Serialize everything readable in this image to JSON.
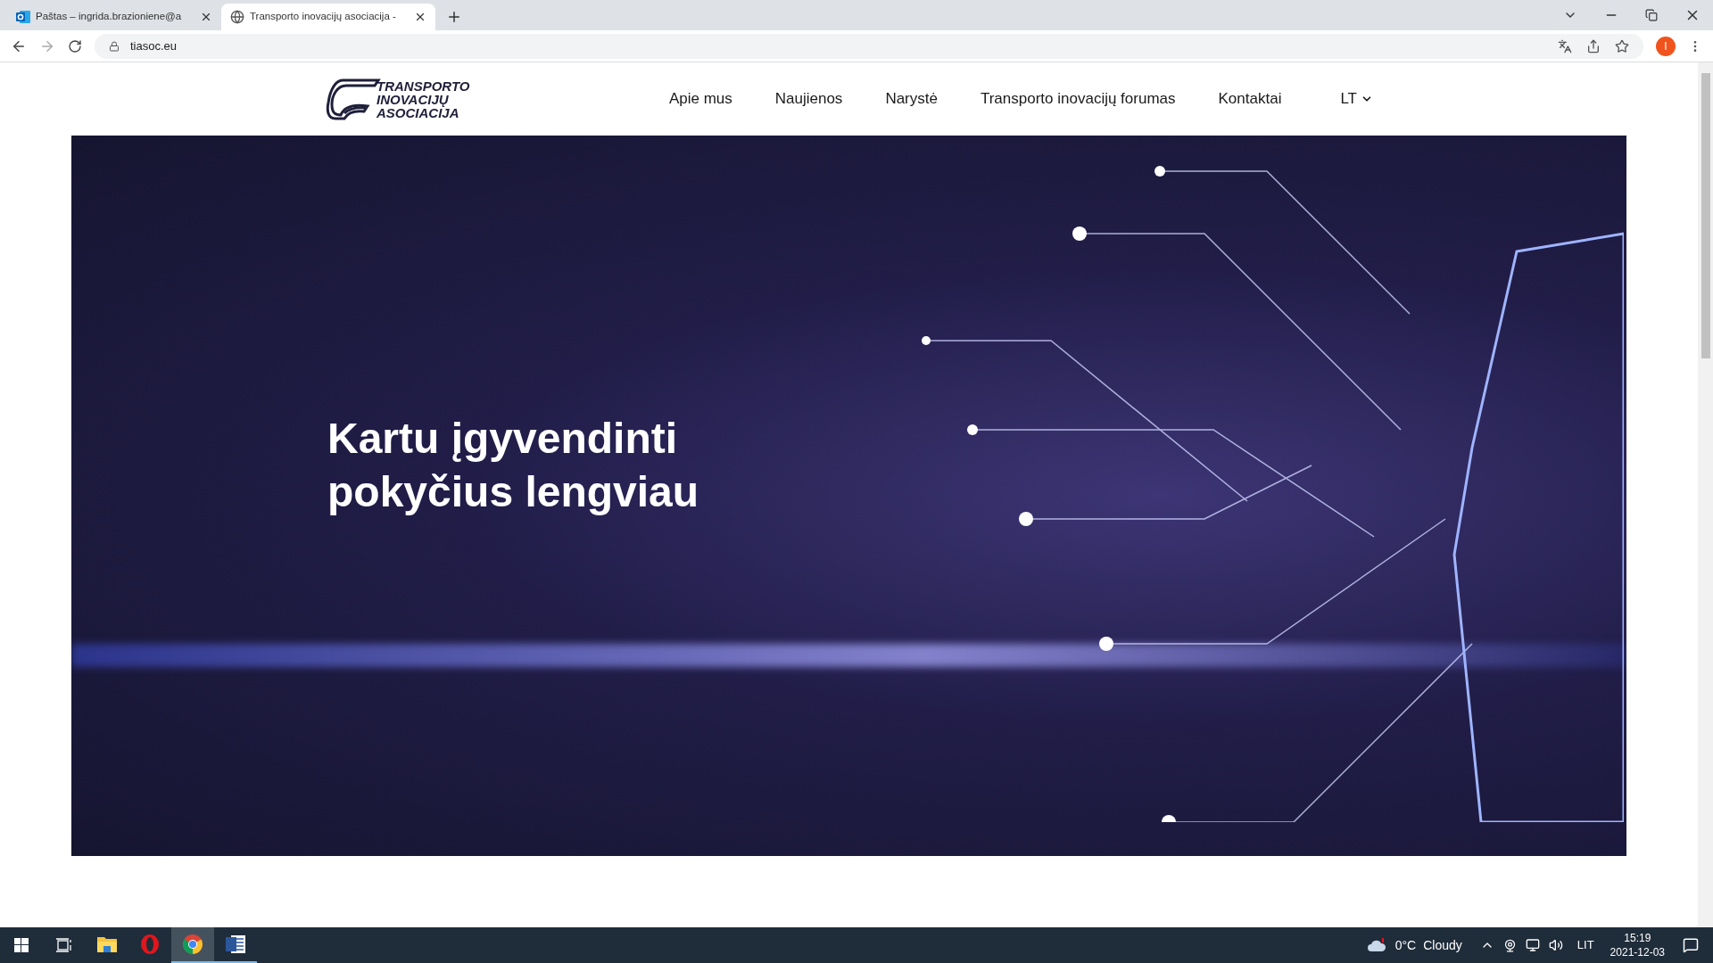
{
  "browser": {
    "tabs": [
      {
        "title": "Paštas – ingrida.brazioniene@a",
        "kind": "mail",
        "selected": false
      },
      {
        "title": "Transporto inovacijų asociacija -",
        "kind": "web",
        "selected": true
      }
    ],
    "address": "tiasoc.eu",
    "profile_initial": "I"
  },
  "site": {
    "logo": [
      "TRANSPORTO",
      "INOVACIJŲ",
      "ASOCIACIJA"
    ],
    "nav": [
      {
        "label": "Apie mus"
      },
      {
        "label": "Naujienos"
      },
      {
        "label": "Narystė"
      },
      {
        "label": "Transporto inovacijų forumas"
      },
      {
        "label": "Kontaktai"
      }
    ],
    "language": "LT",
    "hero": {
      "heading": [
        "Kartu įgyvendinti",
        "pokyčius lengviau"
      ]
    }
  },
  "taskbar": {
    "apps": [
      {
        "kind": "explorer",
        "running": false,
        "active": false
      },
      {
        "kind": "opera",
        "running": false,
        "active": false
      },
      {
        "kind": "chrome",
        "running": true,
        "active": true
      },
      {
        "kind": "word",
        "running": true,
        "active": false
      }
    ],
    "temperature": "0°C",
    "weather": "Cloudy",
    "language": "LIT",
    "time": "15:19",
    "date": "2021-12-03"
  }
}
